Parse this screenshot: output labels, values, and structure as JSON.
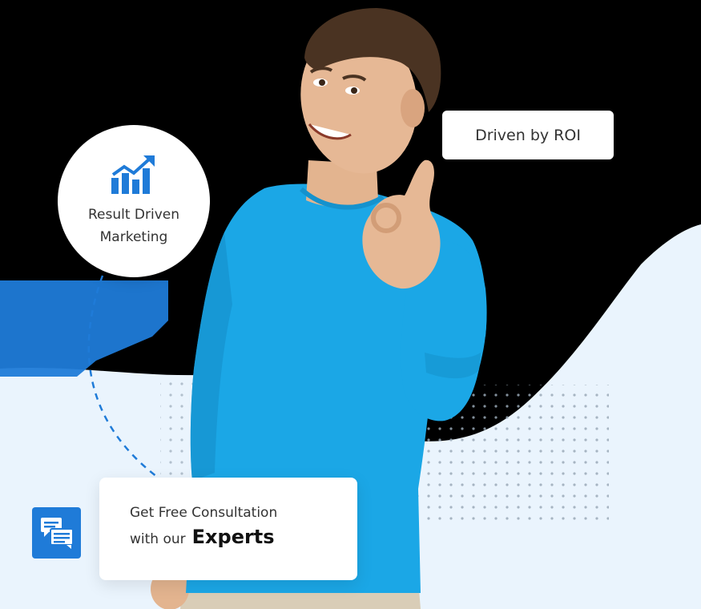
{
  "colors": {
    "background": "#000000",
    "light_blue_bg": "#eaf4fd",
    "brand_blue": "#1f7bd8",
    "sweater_blue": "#1ba7e6",
    "text_dark": "#333333"
  },
  "badges": {
    "result": {
      "icon": "growth-chart-icon",
      "line1": "Result Driven",
      "line2": "Marketing"
    },
    "roi": {
      "label": "Driven by ROI"
    },
    "consultation": {
      "icon": "chat-bubbles-icon",
      "line1": "Get Free Consultation",
      "line2_prefix": "with our",
      "line2_emphasis": "Experts"
    }
  }
}
